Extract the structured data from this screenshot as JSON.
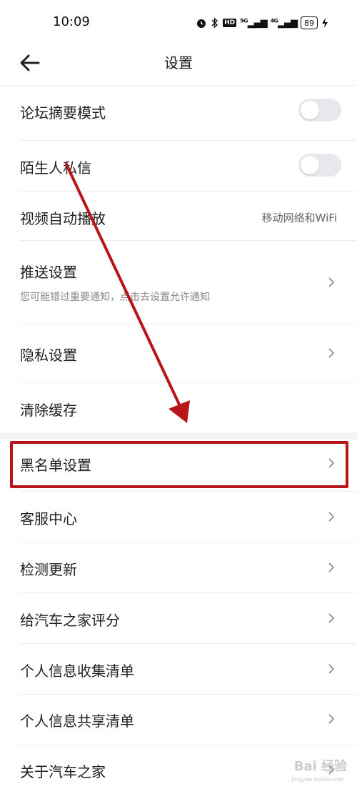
{
  "status_bar": {
    "time": "10:09",
    "icons": [
      "alarm-icon",
      "bluetooth-icon",
      "hd-icon",
      "5g-signal-icon",
      "4g-signal-icon",
      "charging-icon"
    ],
    "hd_label": "HD",
    "signal1_label": "⁵ᴳ",
    "signal2_label": "⁴ᴳ",
    "battery": "89"
  },
  "nav": {
    "title": "设置",
    "back_icon": "arrow-left-icon"
  },
  "settings": {
    "forum_summary": {
      "label": "论坛摘要模式",
      "toggle_on": false
    },
    "stranger_dm": {
      "label": "陌生人私信",
      "toggle_on": false
    },
    "video_autoplay": {
      "label": "视频自动播放",
      "value": "移动网络和WiFi"
    },
    "push": {
      "label": "推送设置",
      "sub": "您可能错过重要通知，点击去设置允许通知"
    },
    "privacy": {
      "label": "隐私设置"
    },
    "clear_cache": {
      "label": "清除缓存"
    },
    "blacklist": {
      "label": "黑名单设置"
    },
    "service": {
      "label": "客服中心"
    },
    "update": {
      "label": "检测更新"
    },
    "rate": {
      "label": "给汽车之家评分"
    },
    "personal_info": {
      "label": "个人信息收集清单"
    },
    "share_info": {
      "label": "个人信息共享清单"
    },
    "about": {
      "label": "关于汽车之家"
    }
  },
  "colors": {
    "annotation_red": "#b8151b",
    "toggle_off": "#e6e8ee",
    "section_gap": "#f3f4f6"
  },
  "watermark": {
    "text": "Bai 经验",
    "sub": "jingyan.baidu.com"
  }
}
